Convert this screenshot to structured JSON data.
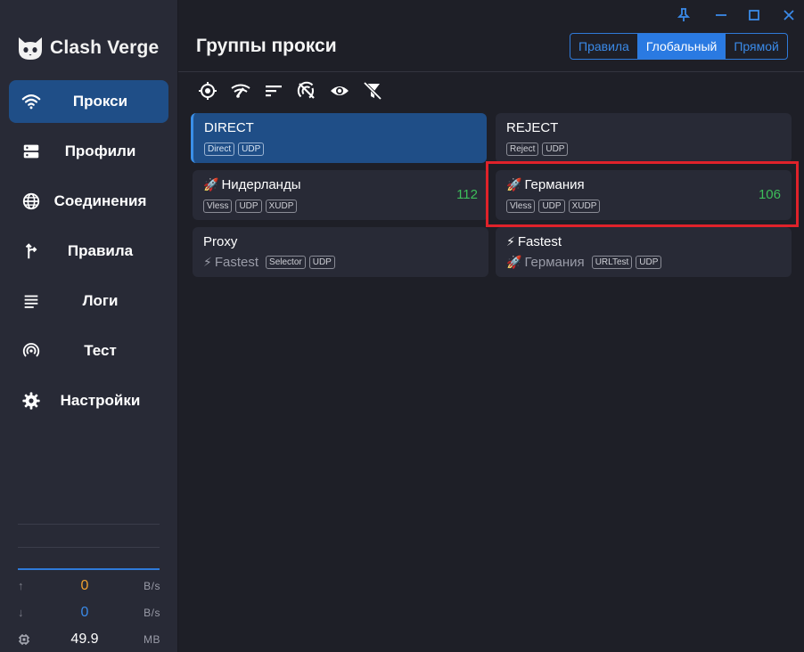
{
  "app": {
    "title": "Clash Verge"
  },
  "nav": [
    {
      "label": "Прокси",
      "icon": "wifi-icon",
      "active": true
    },
    {
      "label": "Профили",
      "icon": "server-icon",
      "active": false
    },
    {
      "label": "Соединения",
      "icon": "globe-icon",
      "active": false
    },
    {
      "label": "Правила",
      "icon": "fork-icon",
      "active": false
    },
    {
      "label": "Логи",
      "icon": "lines-icon",
      "active": false
    },
    {
      "label": "Тест",
      "icon": "radar-icon",
      "active": false
    },
    {
      "label": "Настройки",
      "icon": "gear-icon",
      "active": false
    }
  ],
  "traffic": {
    "upload": {
      "value": "0",
      "unit": "B/s",
      "color": "#f0a030"
    },
    "download": {
      "value": "0",
      "unit": "B/s",
      "color": "#3a8ae8"
    },
    "memory": {
      "value": "49.9",
      "unit": "MB",
      "color": "#ffffff"
    }
  },
  "header": {
    "title": "Группы прокси",
    "modes": [
      {
        "label": "Правила",
        "active": false
      },
      {
        "label": "Глобальный",
        "active": true
      },
      {
        "label": "Прямой",
        "active": false
      }
    ]
  },
  "toolbar": [
    "locate-icon",
    "speed-test-icon",
    "sort-icon",
    "latency-off-icon",
    "eye-icon",
    "filter-off-icon"
  ],
  "cards": [
    {
      "title": "DIRECT",
      "emoji": "",
      "sub": "",
      "sub_emoji": "",
      "tags": [
        "Direct",
        "UDP"
      ],
      "delay": "",
      "selected": true
    },
    {
      "title": "REJECT",
      "emoji": "",
      "sub": "",
      "sub_emoji": "",
      "tags": [
        "Reject",
        "UDP"
      ],
      "delay": "",
      "selected": false
    },
    {
      "title": "Нидерланды",
      "emoji": "🚀",
      "sub": "",
      "sub_emoji": "",
      "tags": [
        "Vless",
        "UDP",
        "XUDP"
      ],
      "delay": "112",
      "selected": false
    },
    {
      "title": "Германия",
      "emoji": "🚀",
      "sub": "",
      "sub_emoji": "",
      "tags": [
        "Vless",
        "UDP",
        "XUDP"
      ],
      "delay": "106",
      "selected": false
    },
    {
      "title": "Proxy",
      "emoji": "",
      "sub": "Fastest",
      "sub_emoji": "⚡",
      "tags": [
        "Selector",
        "UDP"
      ],
      "delay": "",
      "selected": false
    },
    {
      "title": "Fastest",
      "emoji": "⚡",
      "sub": "Германия",
      "sub_emoji": "🚀",
      "tags": [
        "URLTest",
        "UDP"
      ],
      "delay": "",
      "selected": false
    }
  ],
  "colors": {
    "accent": "#2a7ae2",
    "highlight": "#e0222a",
    "delay": "#3dbe5a"
  }
}
